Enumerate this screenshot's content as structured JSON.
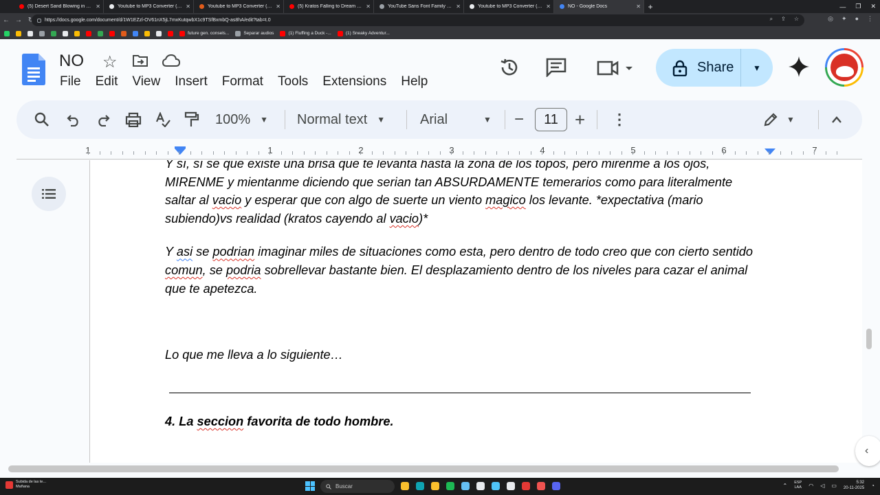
{
  "browser": {
    "tabs": [
      {
        "title": "(5) Desert Sand Blowing in Wind",
        "color": "#ff0000",
        "active": false
      },
      {
        "title": "Youtube to MP3 Converter (Ad-fr",
        "color": "#e8eaed",
        "active": false
      },
      {
        "title": "Youtube to MP3 Converter (Ad-fr",
        "color": "#e25c1b",
        "active": false
      },
      {
        "title": "(5) Kratos Falling to Dream on -",
        "color": "#ff0000",
        "active": false
      },
      {
        "title": "YouTube Sans Font Family Down",
        "color": "#9aa0a6",
        "active": false
      },
      {
        "title": "Youtube to MP3 Converter (Ad-fr",
        "color": "#e8eaed",
        "active": false
      },
      {
        "title": "NO - Google Docs",
        "color": "#4285f4",
        "active": true
      }
    ],
    "new_tab": "+",
    "url": "https://docs.google.com/document/d/1W1EZzl-OV61nX5jL7mxKutqwbX1c9TSfBxmbQ-as8hA/edit?tab=t.0",
    "bookmarks": [
      {
        "label": "",
        "color": "#25d366"
      },
      {
        "label": "",
        "color": "#fbbc04"
      },
      {
        "label": "",
        "color": "#e8eaed"
      },
      {
        "label": "",
        "color": "#9aa0a6"
      },
      {
        "label": "",
        "color": "#34a853"
      },
      {
        "label": "",
        "color": "#e8eaed"
      },
      {
        "label": "",
        "color": "#fbbc04"
      },
      {
        "label": "",
        "color": "#ff0000"
      },
      {
        "label": "",
        "color": "#34a853"
      },
      {
        "label": "",
        "color": "#ff0000"
      },
      {
        "label": "",
        "color": "#e25c1b"
      },
      {
        "label": "",
        "color": "#4285f4"
      },
      {
        "label": "",
        "color": "#fbbc04"
      },
      {
        "label": "",
        "color": "#e8eaed"
      },
      {
        "label": "",
        "color": "#ff0000"
      },
      {
        "label": "future gen. consels...",
        "color": "#ff0000"
      },
      {
        "label": "Separar audios",
        "color": "#9aa0a6"
      },
      {
        "label": "(1) Fluffing a Duck -...",
        "color": "#ff0000"
      },
      {
        "label": "(1) Sneaky Adventur...",
        "color": "#ff0000"
      }
    ]
  },
  "docs": {
    "title": "NO",
    "menu": [
      "File",
      "Edit",
      "View",
      "Insert",
      "Format",
      "Tools",
      "Extensions",
      "Help"
    ],
    "share_label": "Share",
    "toolbar": {
      "zoom": "100%",
      "style": "Normal text",
      "font": "Arial",
      "font_size": "11",
      "minus": "−",
      "plus": "+"
    },
    "ruler_numbers": [
      "1",
      "1",
      "2",
      "3",
      "4",
      "5",
      "6",
      "7"
    ],
    "body": {
      "p1": [
        {
          "t": "Y sí, sí se que existe una brisa que te levanta hasta la zona de los topos, pero mirenme a los ojos, MIRENME  y mientanme diciendo que serian tan ABSURDAMENTE temerarios como para literalmente saltar al ",
          "s": ""
        },
        {
          "t": "vacio",
          "s": "sq"
        },
        {
          "t": " y esperar que con algo de suerte un viento ",
          "s": ""
        },
        {
          "t": "magico",
          "s": "sq"
        },
        {
          "t": " los levante. *expectativa (mario subiendo)vs realidad (kratos cayendo al ",
          "s": ""
        },
        {
          "t": "vacio",
          "s": "sq"
        },
        {
          "t": ")*",
          "s": ""
        }
      ],
      "p2": [
        {
          "t": "Y ",
          "s": ""
        },
        {
          "t": "asi",
          "s": "sqb"
        },
        {
          "t": " se ",
          "s": ""
        },
        {
          "t": "podrian",
          "s": "sq"
        },
        {
          "t": " imaginar miles de situaciones como esta, pero dentro de todo creo que con cierto sentido ",
          "s": ""
        },
        {
          "t": "comun",
          "s": "sq"
        },
        {
          "t": ", se ",
          "s": ""
        },
        {
          "t": "podria",
          "s": "sq"
        },
        {
          "t": " sobrellevar bastante bien. El desplazamiento dentro de los niveles para cazar el animal que te apetezca.",
          "s": ""
        }
      ],
      "p3": "Lo que me lleva a lo siguiente…",
      "heading": [
        {
          "t": "4. La ",
          "s": ""
        },
        {
          "t": "seccion",
          "s": "sq"
        },
        {
          "t": " favorita de todo hombre.",
          "s": ""
        }
      ]
    }
  },
  "taskbar": {
    "notification_line1": "Subida de las te...",
    "notification_line2": "Mañana",
    "search_label": "Buscar",
    "lang_line1": "ESP",
    "lang_line2": "LAA",
    "time": "5:32",
    "date": "20-11-2025",
    "apps": [
      {
        "name": "file-explorer-icon",
        "color": "#fbc02d"
      },
      {
        "name": "edge-icon",
        "color": "#0fa3b1"
      },
      {
        "name": "folder-icon",
        "color": "#fbc02d"
      },
      {
        "name": "spotify-icon",
        "color": "#1db954"
      },
      {
        "name": "steam-icon",
        "color": "#66c0f4"
      },
      {
        "name": "chrome-icon",
        "color": "#e8eaed"
      },
      {
        "name": "notepad-icon",
        "color": "#4fc3f7"
      },
      {
        "name": "capcut-icon",
        "color": "#e8eaed"
      },
      {
        "name": "app-red-icon",
        "color": "#e53935"
      },
      {
        "name": "media-icon",
        "color": "#ef5350"
      },
      {
        "name": "discord-icon",
        "color": "#5865f2"
      }
    ]
  }
}
